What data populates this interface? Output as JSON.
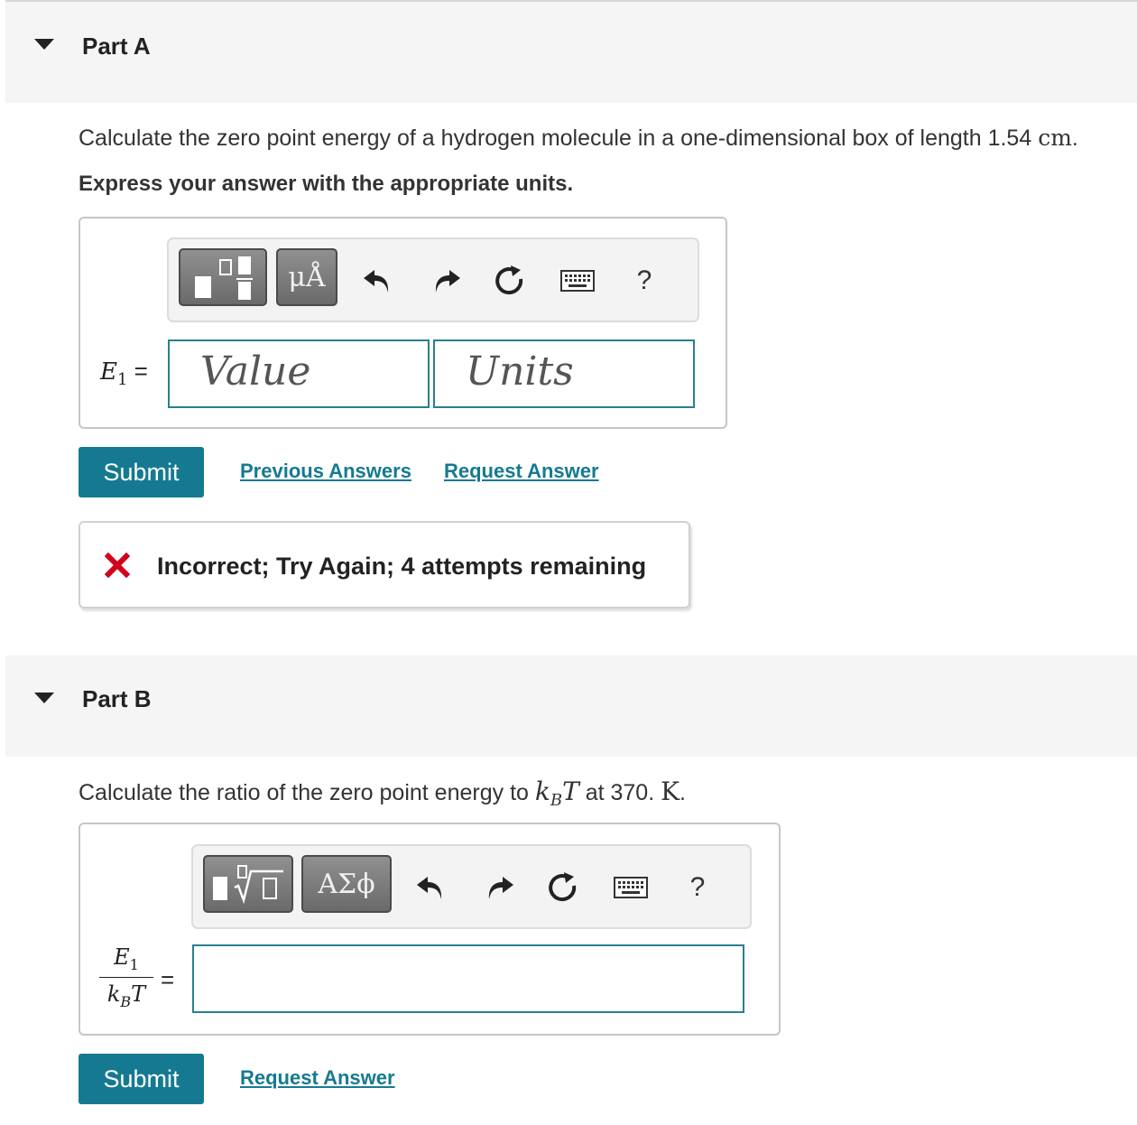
{
  "partA": {
    "header": "Part A",
    "question_prefix": "Calculate the zero point energy of a hydrogen molecule in a one-dimensional box of length 1.54 ",
    "question_unit": "cm",
    "question_end": ".",
    "instruction": "Express your answer with the appropriate units.",
    "toolbar": {
      "units_button": "μÅ",
      "help": "?"
    },
    "var_symbol": "E",
    "var_subscript": "1",
    "equals": "=",
    "value_placeholder": "Value",
    "units_placeholder": "Units",
    "submit_label": "Submit",
    "previous_answers_label": "Previous Answers",
    "request_answer_label": "Request Answer",
    "feedback": "Incorrect; Try Again; 4 attempts remaining"
  },
  "partB": {
    "header": "Part B",
    "question_prefix": "Calculate the ratio of the zero point energy to ",
    "kB_k": "k",
    "kB_sub": "B",
    "kB_T": "T",
    "question_mid": " at 370. ",
    "question_unit": "K",
    "question_end": ".",
    "toolbar": {
      "sqrt_symbol": "√",
      "greek_button": "ΑΣϕ",
      "help": "?"
    },
    "frac_num_symbol": "E",
    "frac_num_sub": "1",
    "frac_den_k": "k",
    "frac_den_sub": "B",
    "frac_den_T": "T",
    "equals": "=",
    "input_value": "",
    "submit_label": "Submit",
    "request_answer_label": "Request Answer"
  },
  "colors": {
    "accent": "#157a91",
    "input_border": "#2a7f8f",
    "error": "#d0021b",
    "header_bg": "#f5f5f5"
  },
  "icons": [
    "caret-down-icon",
    "templates-icon",
    "undo-icon",
    "redo-icon",
    "reset-icon",
    "keyboard-icon",
    "help-icon",
    "error-x-icon"
  ]
}
